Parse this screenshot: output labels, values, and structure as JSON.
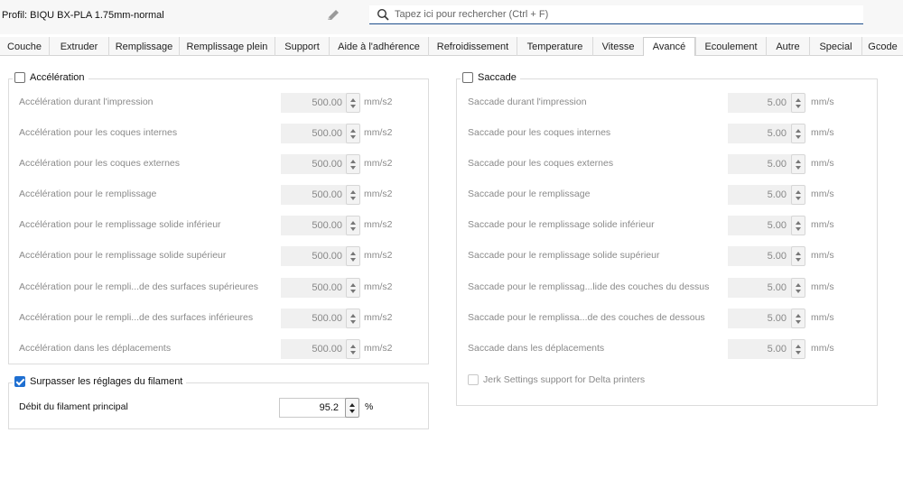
{
  "header": {
    "profile": "Profil: BIQU BX-PLA 1.75mm-normal",
    "search_placeholder": "Tapez ici pour rechercher (Ctrl + F)",
    "edit_icon": "pencil-icon",
    "search_icon": "magnifier-icon"
  },
  "tabs": [
    {
      "label": "Couche"
    },
    {
      "label": "Extruder"
    },
    {
      "label": "Remplissage"
    },
    {
      "label": "Remplissage plein"
    },
    {
      "label": "Support"
    },
    {
      "label": "Aide à l'adhérence"
    },
    {
      "label": "Refroidissement"
    },
    {
      "label": "Temperature"
    },
    {
      "label": "Vitesse"
    },
    {
      "label": "Avancé",
      "active": true
    },
    {
      "label": "Ecoulement"
    },
    {
      "label": "Autre"
    },
    {
      "label": "Special"
    },
    {
      "label": "Gcode"
    }
  ],
  "acceleration": {
    "title": "Accélération",
    "checked": false,
    "rows": [
      {
        "label": "Accélération durant l'impression",
        "value": "500.00",
        "unit": "mm/s2"
      },
      {
        "label": "Accélération pour les coques internes",
        "value": "500.00",
        "unit": "mm/s2"
      },
      {
        "label": "Accélération pour les coques externes",
        "value": "500.00",
        "unit": "mm/s2"
      },
      {
        "label": "Accélération pour le remplissage",
        "value": "500.00",
        "unit": "mm/s2"
      },
      {
        "label": "Accélération pour le remplissage solide inférieur",
        "value": "500.00",
        "unit": "mm/s2"
      },
      {
        "label": "Accélération pour le remplissage solide supérieur",
        "value": "500.00",
        "unit": "mm/s2"
      },
      {
        "label": "Accélération pour le rempli...de des surfaces supérieures",
        "value": "500.00",
        "unit": "mm/s2"
      },
      {
        "label": "Accélération pour le rempli...de des surfaces inférieures",
        "value": "500.00",
        "unit": "mm/s2"
      },
      {
        "label": "Accélération dans les déplacements",
        "value": "500.00",
        "unit": "mm/s2"
      }
    ]
  },
  "saccade": {
    "title": "Saccade",
    "checked": false,
    "rows": [
      {
        "label": "Saccade durant l'impression",
        "value": "5.00",
        "unit": "mm/s"
      },
      {
        "label": "Saccade pour les coques internes",
        "value": "5.00",
        "unit": "mm/s"
      },
      {
        "label": "Saccade pour les coques externes",
        "value": "5.00",
        "unit": "mm/s"
      },
      {
        "label": "Saccade pour le remplissage",
        "value": "5.00",
        "unit": "mm/s"
      },
      {
        "label": "Saccade pour le remplissage solide inférieur",
        "value": "5.00",
        "unit": "mm/s"
      },
      {
        "label": "Saccade pour le remplissage solide supérieur",
        "value": "5.00",
        "unit": "mm/s"
      },
      {
        "label": "Saccade pour le remplissag...lide des couches du dessus",
        "value": "5.00",
        "unit": "mm/s"
      },
      {
        "label": "Saccade pour le remplissa...de des couches de dessous",
        "value": "5.00",
        "unit": "mm/s"
      },
      {
        "label": "Saccade dans les déplacements",
        "value": "5.00",
        "unit": "mm/s"
      }
    ],
    "jerk_label": "Jerk Settings support for Delta printers"
  },
  "filament": {
    "title": "Surpasser les réglages du filament",
    "checked": true,
    "row": {
      "label": "Débit du filament principal",
      "value": "95.2",
      "unit": "%"
    }
  },
  "colors": {
    "accent": "#1f6fd1",
    "disabled_text": "#8a8a8a"
  }
}
